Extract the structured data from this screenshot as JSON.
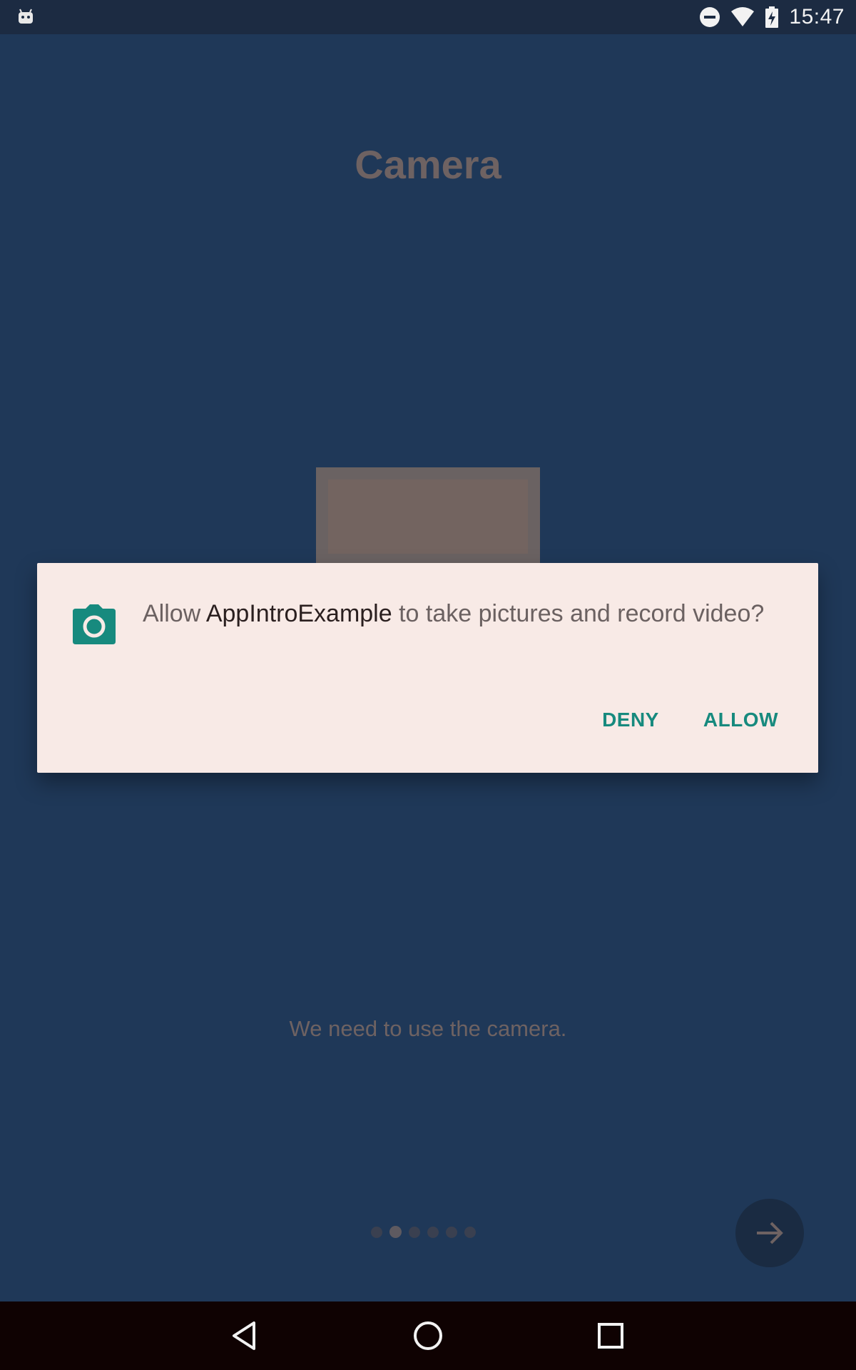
{
  "status_bar": {
    "time": "15:47",
    "icons": [
      "android-debug-icon",
      "do-not-disturb-icon",
      "wifi-icon",
      "battery-charging-icon"
    ]
  },
  "page": {
    "title": "Camera",
    "description": "We need to use the camera.",
    "pager": {
      "total": 6,
      "current_index": 1
    }
  },
  "dialog": {
    "icon": "camera-icon",
    "message_prefix": "Allow ",
    "app_name": "AppIntroExample",
    "message_suffix": " to take pictures and record video?",
    "deny_label": "DENY",
    "allow_label": "ALLOW"
  },
  "nav_bar": {
    "icons": [
      "back-icon",
      "home-icon",
      "recents-icon"
    ]
  },
  "colors": {
    "background": "#1f3858",
    "dialog_bg": "#f8eae6",
    "accent": "#178a7e",
    "dimmed_text": "#6e6262"
  }
}
